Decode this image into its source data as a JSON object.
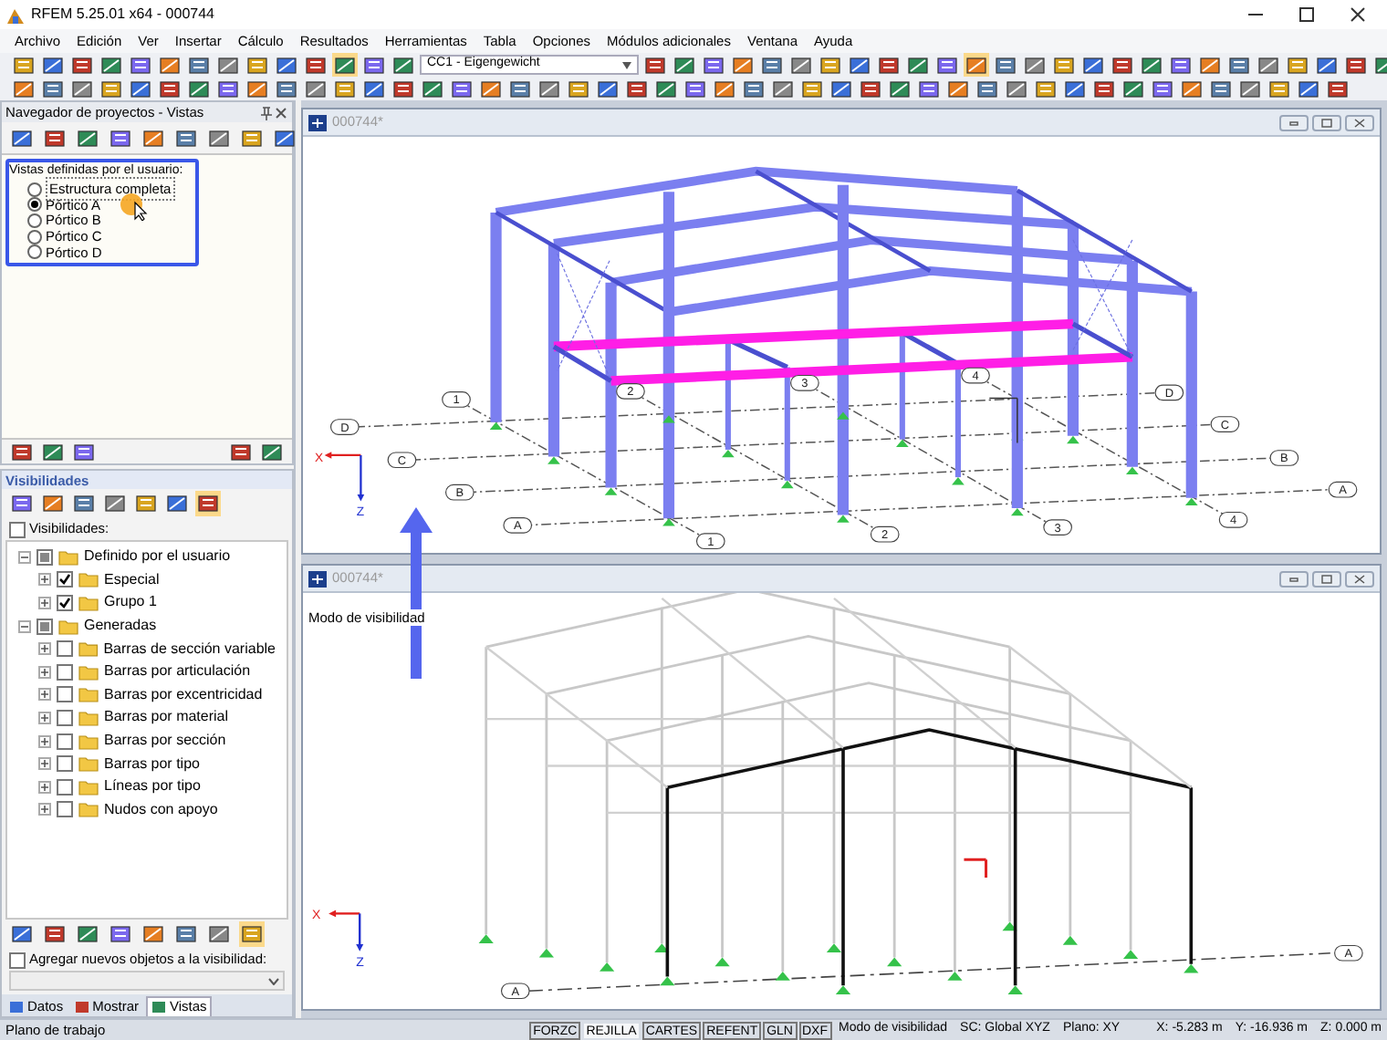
{
  "window": {
    "title": "RFEM 5.25.01 x64 - 000744"
  },
  "menu": [
    "Archivo",
    "Edición",
    "Ver",
    "Insertar",
    "Cálculo",
    "Resultados",
    "Herramientas",
    "Tabla",
    "Opciones",
    "Módulos adicionales",
    "Ventana",
    "Ayuda"
  ],
  "toolbar": {
    "load_case": "CC1 - Eigengewicht"
  },
  "navigator": {
    "title": "Navegador de proyectos - Vistas",
    "views_label": "Vistas definidas por el usuario:",
    "views": [
      {
        "label": "Estructura completa",
        "selected": false
      },
      {
        "label": "Pórtico A",
        "selected": true
      },
      {
        "label": "Pórtico B",
        "selected": false
      },
      {
        "label": "Pórtico C",
        "selected": false
      },
      {
        "label": "Pórtico D",
        "selected": false
      }
    ]
  },
  "visibility": {
    "title": "Visibilidades",
    "toggle": {
      "label": "Visibilidades:",
      "checked": false
    },
    "tree": [
      {
        "label": "Definido por el usuario",
        "checked": false,
        "partial": true,
        "expanded": true,
        "children": [
          {
            "label": "Especial",
            "checked": true,
            "expanded": false
          },
          {
            "label": "Grupo 1",
            "checked": true,
            "expanded": false
          }
        ]
      },
      {
        "label": "Generadas",
        "checked": false,
        "partial": true,
        "expanded": true,
        "children": [
          {
            "label": "Barras de sección variable",
            "checked": false,
            "partial": false,
            "expanded": false
          },
          {
            "label": "Barras por articulación",
            "checked": false,
            "partial": false,
            "expanded": false
          },
          {
            "label": "Barras por excentricidad",
            "checked": false,
            "partial": false,
            "expanded": false
          },
          {
            "label": "Barras por material",
            "checked": false,
            "partial": false,
            "expanded": false
          },
          {
            "label": "Barras por sección",
            "checked": false,
            "partial": false,
            "expanded": false
          },
          {
            "label": "Barras por tipo",
            "checked": false,
            "partial": false,
            "expanded": false
          },
          {
            "label": "Líneas por tipo",
            "checked": false,
            "partial": false,
            "expanded": false
          },
          {
            "label": "Nudos con apoyo",
            "checked": false,
            "partial": false,
            "expanded": false
          }
        ]
      }
    ],
    "add_new": {
      "label": "Agregar nuevos objetos a la visibilidad:",
      "checked": false
    }
  },
  "panel_tabs": [
    {
      "label": "Datos",
      "selected": false
    },
    {
      "label": "Mostrar",
      "selected": false
    },
    {
      "label": "Vistas",
      "selected": true
    }
  ],
  "views": [
    {
      "title": "000744*",
      "axis_labels": [
        "X",
        "Z"
      ],
      "grid_labels": [
        "1",
        "2",
        "3",
        "4",
        "D",
        "C",
        "B",
        "A",
        "D",
        "C",
        "B",
        "A",
        "1",
        "2",
        "3",
        "4"
      ]
    },
    {
      "title": "000744*",
      "mode_label": "Modo de visibilidad",
      "axis_labels": [
        "X",
        "Z"
      ],
      "grid_labels": [
        "A",
        "A"
      ]
    }
  ],
  "status_bar": {
    "left": "Plano de trabajo",
    "toggles": [
      {
        "label": "FORZC",
        "on": false
      },
      {
        "label": "REJILLA",
        "on": true
      },
      {
        "label": "CARTES",
        "on": false
      },
      {
        "label": "REFENT",
        "on": false
      },
      {
        "label": "GLN",
        "on": false
      },
      {
        "label": "DXF",
        "on": false
      }
    ],
    "mode": "Modo de visibilidad",
    "coordinate_system": "SC: Global XYZ",
    "plane": "Plano: XY",
    "x": "X: -5.283 m",
    "y": "Y: -16.936 m",
    "z": "Z: 0.000 m"
  }
}
